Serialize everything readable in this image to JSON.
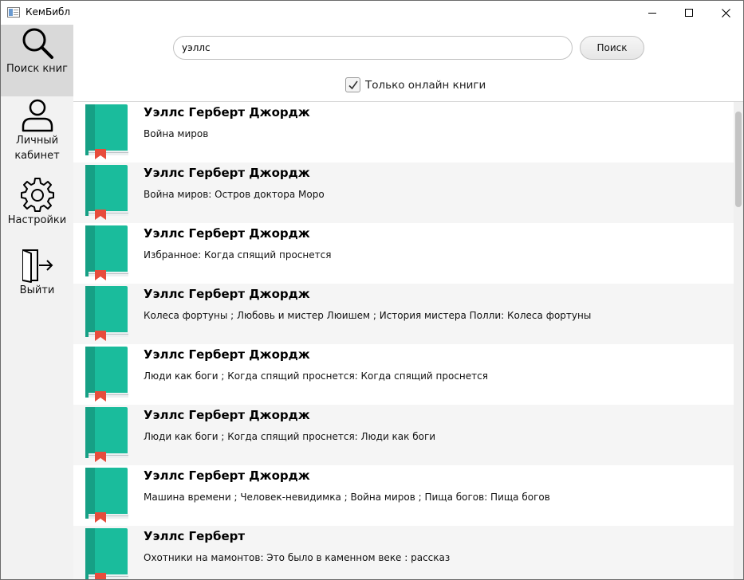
{
  "window": {
    "title": "КемБибл"
  },
  "sidebar": {
    "items": [
      {
        "label": "Поиск книг",
        "icon": "search-icon",
        "active": true
      },
      {
        "label": "Личный кабинет",
        "icon": "user-icon",
        "active": false
      },
      {
        "label": "Настройки",
        "icon": "gear-icon",
        "active": false
      },
      {
        "label": "Выйти",
        "icon": "exit-icon",
        "active": false
      }
    ]
  },
  "search": {
    "value": "уэллс",
    "button_label": "Поиск",
    "online_only_label": "Только онлайн книги",
    "online_only_checked": true
  },
  "colors": {
    "book_cover": "#1abc9c",
    "book_spine": "#16a085",
    "bookmark": "#e74c3c",
    "active_nav": "#d9d9d9",
    "sidebar_bg": "#f2f2f2",
    "alt_row": "#f5f5f5"
  },
  "results": [
    {
      "author": "Уэллс Герберт Джордж",
      "title": "Война миров"
    },
    {
      "author": "Уэллс Герберт Джордж",
      "title": "Война миров: Остров доктора Моро"
    },
    {
      "author": "Уэллс Герберт Джордж",
      "title": "Избранное: Когда спящий проснется"
    },
    {
      "author": "Уэллс Герберт Джордж",
      "title": "Колеса фортуны ; Любовь и мистер Люишем ; История мистера Полли: Колеса фортуны"
    },
    {
      "author": "Уэллс Герберт Джордж",
      "title": "Люди как боги ; Когда спящий проснется: Когда спящий проснется"
    },
    {
      "author": "Уэллс Герберт Джордж",
      "title": "Люди как боги ; Когда спящий проснется: Люди как боги"
    },
    {
      "author": "Уэллс Герберт Джордж",
      "title": "Машина времени ; Человек-невидимка ; Война миров ; Пища богов: Пища богов"
    },
    {
      "author": "Уэллс Герберт",
      "title": "Охотники на мамонтов: Это было в каменном веке : рассказ"
    }
  ]
}
